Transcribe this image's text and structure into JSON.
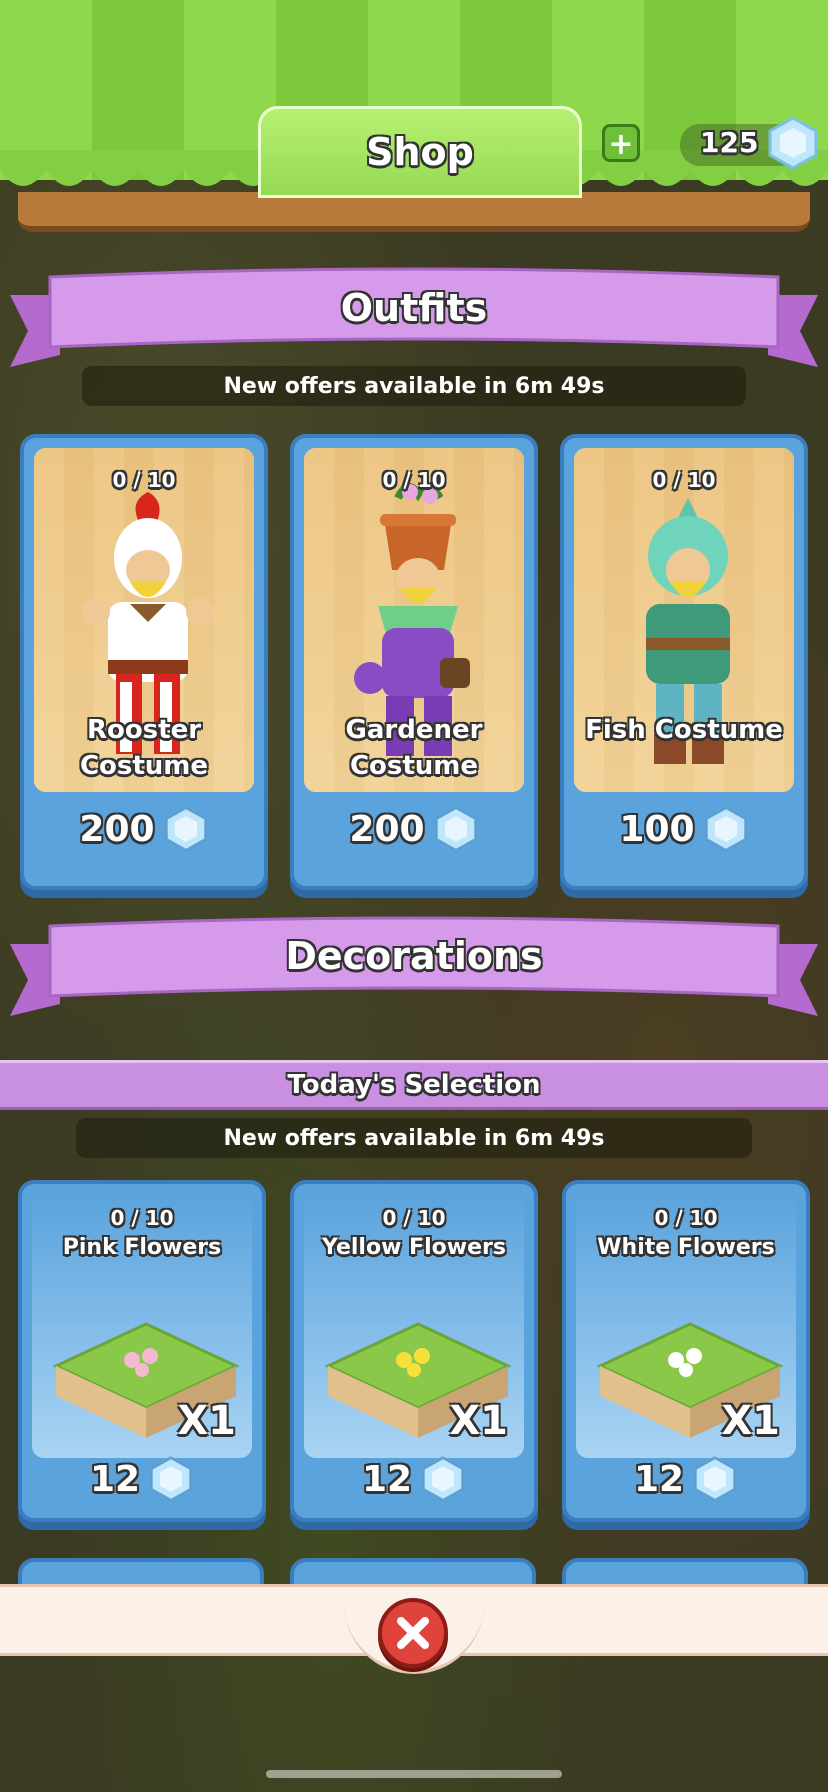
{
  "header": {
    "title": "Shop",
    "plus_label": "+",
    "gem_count": "125"
  },
  "outfits": {
    "section_title": "Outfits",
    "timer": "New offers available in 6m 49s",
    "items": [
      {
        "count": "0 / 10",
        "name_line1": "Rooster",
        "name_line2": "Costume",
        "price": "200"
      },
      {
        "count": "0 / 10",
        "name_line1": "Gardener",
        "name_line2": "Costume",
        "price": "200"
      },
      {
        "count": "0 / 10",
        "name_line1": "Fish Costume",
        "name_line2": "",
        "price": "100"
      }
    ]
  },
  "decorations": {
    "section_title": "Decorations",
    "subsection_title": "Today's Selection",
    "timer": "New offers available in 6m 49s",
    "items": [
      {
        "count": "0 / 10",
        "name": "Pink Flowers",
        "quantity": "X1",
        "price": "12",
        "flower_color": "#f5b8d0"
      },
      {
        "count": "0 / 10",
        "name": "Yellow Flowers",
        "quantity": "X1",
        "price": "12",
        "flower_color": "#f7e03a"
      },
      {
        "count": "0 / 10",
        "name": "White Flowers",
        "quantity": "X1",
        "price": "12",
        "flower_color": "#ffffff"
      }
    ]
  },
  "colors": {
    "awning_green": "#8ed84c",
    "ribbon_purple": "#d59ae9",
    "card_blue": "#5aa3dd",
    "close_red": "#e0433b"
  },
  "icons": {
    "currency": "gem-icon",
    "close": "close-icon",
    "add": "plus-icon"
  }
}
